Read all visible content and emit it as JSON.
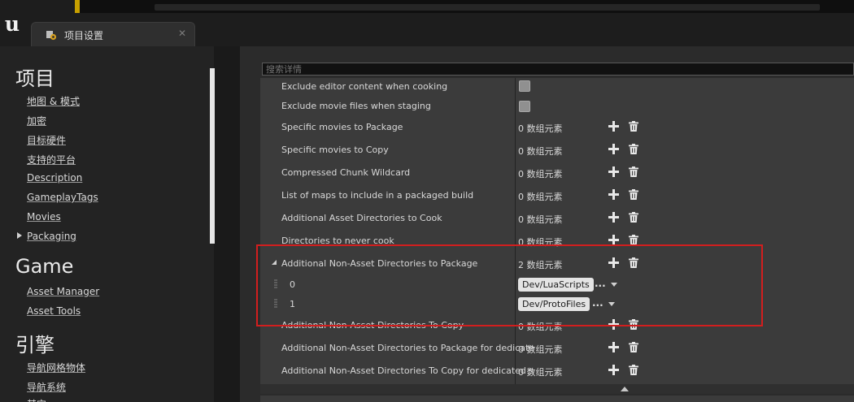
{
  "tab": {
    "label": "项目设置",
    "icon": "settings-gear-icon"
  },
  "search": {
    "placeholder": "搜索详情"
  },
  "sidebar": {
    "sections": [
      {
        "title": "项目",
        "items": [
          "地图 & 模式",
          "加密",
          "目标硬件",
          "支持的平台",
          "Description",
          "GameplayTags",
          "Movies",
          "Packaging"
        ]
      },
      {
        "title": "Game",
        "items": [
          "Asset Manager",
          "Asset Tools"
        ]
      },
      {
        "title": "引擎",
        "items": [
          "导航网格物体",
          "导航系统",
          "其它"
        ]
      }
    ]
  },
  "details": {
    "rows": [
      {
        "label": "Exclude editor content when cooking",
        "kind": "checkbox",
        "checked": false
      },
      {
        "label": "Exclude movie files when staging",
        "kind": "checkbox",
        "checked": false
      },
      {
        "label": "Specific movies to Package",
        "value": "0 数组元素"
      },
      {
        "label": "Specific movies to Copy",
        "value": "0 数组元素"
      },
      {
        "label": "Compressed Chunk Wildcard",
        "value": "0 数组元素"
      },
      {
        "label": "List of maps to include in a packaged build",
        "value": "0 数组元素"
      },
      {
        "label": "Additional Asset Directories to Cook",
        "value": "0 数组元素"
      },
      {
        "label": "Directories to never cook",
        "value": "0 数组元素"
      },
      {
        "label": "Additional Non-Asset Directories to Package",
        "value": "2 数组元素",
        "expanded": true
      },
      {
        "label": "Additional Non-Asset Directories To Copy",
        "value": "0 数组元素"
      },
      {
        "label": "Additional Non-Asset Directories to Package for dedicate",
        "value": "0 数组元素"
      },
      {
        "label": "Additional Non-Asset Directories To Copy for dedicated s",
        "value": "0 数组元素"
      }
    ],
    "array_elements": [
      {
        "index": "0",
        "value": "Dev/LuaScripts",
        "more": "..."
      },
      {
        "index": "1",
        "value": "Dev/ProtoFiles",
        "more": "..."
      }
    ]
  },
  "colors": {
    "highlight_box": "#d21e1e",
    "panel": "#3b3b3b",
    "pill": "#e4e4e4"
  }
}
